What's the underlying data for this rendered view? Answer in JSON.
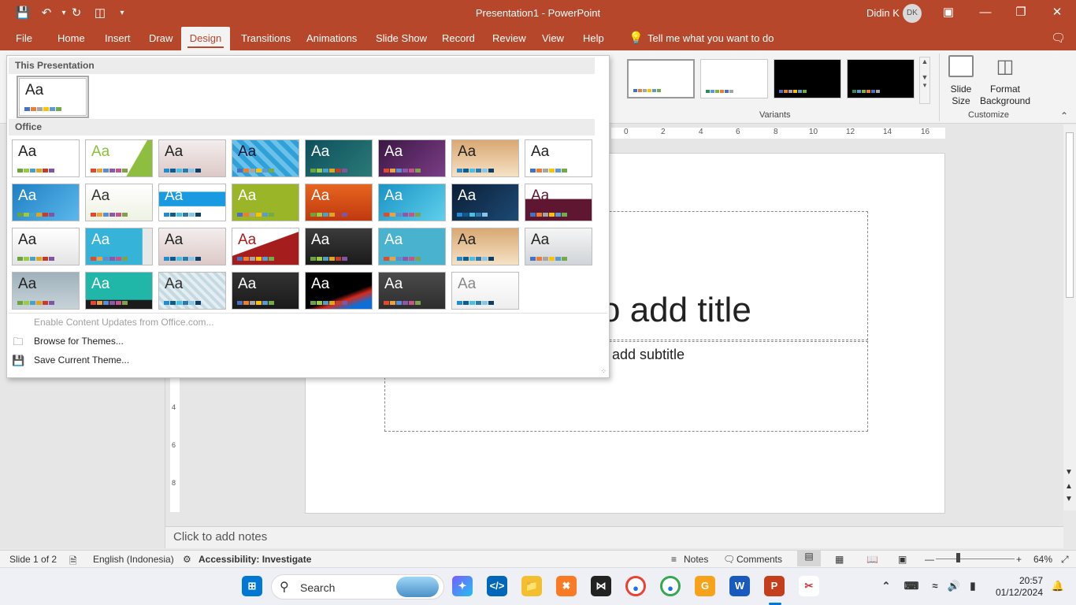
{
  "titlebar": {
    "title": "Presentation1  -  PowerPoint",
    "user": "Didin K",
    "avatar_initials": "DK"
  },
  "tabs": [
    "File",
    "Home",
    "Insert",
    "Draw",
    "Design",
    "Transitions",
    "Animations",
    "Slide Show",
    "Record",
    "Review",
    "View",
    "Help"
  ],
  "active_tab": "Design",
  "tell_me": "Tell me what you want to do",
  "ribbon": {
    "variants_label": "Variants",
    "customize_label": "Customize",
    "slide_size": "Slide Size",
    "format_background": "Format Background"
  },
  "gallery": {
    "this_presentation": "This Presentation",
    "office": "Office",
    "enable_updates": "Enable Content Updates from Office.com...",
    "browse_themes": "Browse for Themes...",
    "save_theme": "Save Current Theme...",
    "aa": "Aa"
  },
  "slide": {
    "title_text": "o add title",
    "subtitle_text": "add subtitle",
    "notes_text": "Click to add notes"
  },
  "ruler": {
    "h_ticks": [
      "0",
      "2",
      "4",
      "6",
      "8",
      "10",
      "12",
      "14",
      "16"
    ],
    "v_ticks": [
      "4",
      "6",
      "8"
    ]
  },
  "status": {
    "slide": "Slide 1 of 2",
    "language": "English (Indonesia)",
    "accessibility": "Accessibility: Investigate",
    "notes": "Notes",
    "comments": "Comments",
    "zoom": "64%"
  },
  "taskbar": {
    "search": "Search",
    "time": "20:57",
    "date": "01/12/2024"
  }
}
